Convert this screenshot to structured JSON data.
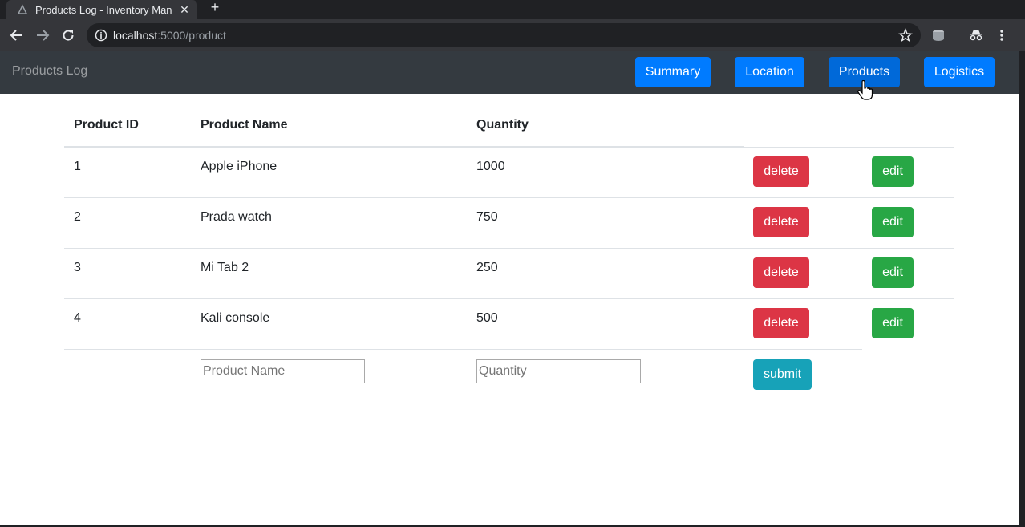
{
  "browser": {
    "tab_title": "Products Log - Inventory Man",
    "tab_close": "✕",
    "new_tab": "+",
    "url_host": "localhost",
    "url_rest": ":5000/product"
  },
  "navbar": {
    "brand": "Products Log",
    "links": [
      "Summary",
      "Location",
      "Products",
      "Logistics"
    ],
    "active": "Products"
  },
  "table": {
    "headers": [
      "Product ID",
      "Product Name",
      "Quantity"
    ],
    "rows": [
      {
        "id": "1",
        "name": "Apple iPhone",
        "quantity": "1000",
        "delete": "delete",
        "edit": "edit"
      },
      {
        "id": "2",
        "name": "Prada watch",
        "quantity": "750",
        "delete": "delete",
        "edit": "edit"
      },
      {
        "id": "3",
        "name": "Mi Tab 2",
        "quantity": "250",
        "delete": "delete",
        "edit": "edit"
      },
      {
        "id": "4",
        "name": "Kali console",
        "quantity": "500",
        "delete": "delete",
        "edit": "edit"
      }
    ]
  },
  "form": {
    "name_placeholder": "Product Name",
    "quantity_placeholder": "Quantity",
    "submit": "submit"
  },
  "colors": {
    "navbar_bg": "#343a40",
    "primary": "#007bff",
    "danger": "#dc3545",
    "success": "#28a745",
    "info": "#17a2b8"
  },
  "icons": [
    "app-favicon",
    "back-arrow-icon",
    "forward-arrow-icon",
    "reload-icon",
    "info-icon",
    "star-icon",
    "database-extension-icon",
    "incognito-extension-icon",
    "kebab-menu-icon",
    "hand-pointer-cursor"
  ]
}
